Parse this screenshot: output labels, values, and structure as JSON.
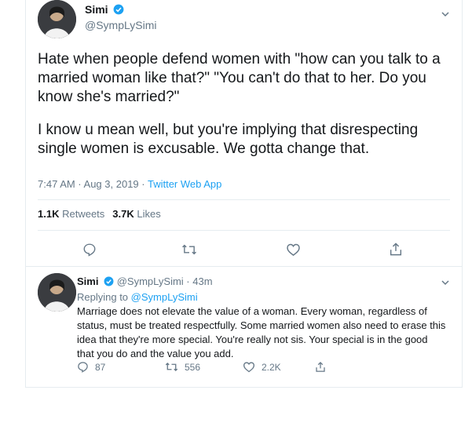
{
  "tweet": {
    "author_name": "Simi",
    "author_handle": "@SympLySimi",
    "text_paragraph_1": "Hate when people defend women with \"how can you talk to a married woman like that?\" \"You can't do that to her. Do you know she's married?\"",
    "text_paragraph_2": "I know u mean well, but you're implying that disrespecting single women is excusable. We gotta change that.",
    "time_date": "7:47 AM · Aug 3, 2019 · ",
    "source_app": "Twitter Web App",
    "retweets_count": "1.1K",
    "retweets_label": "Retweets",
    "likes_count": "3.7K",
    "likes_label": "Likes",
    "icons": [
      "reply-icon",
      "retweet-icon",
      "like-icon",
      "share-icon"
    ]
  },
  "reply": {
    "author_name": "Simi",
    "author_handle": "@SympLySimi",
    "time_ago": "· 43m",
    "replying_to_label": "Replying to ",
    "replying_to_handle": "@SympLySimi",
    "text": "Marriage does not elevate the value of a woman. Every woman, regardless of status, must be treated respectfully. Some married women also need to erase this idea that they're more special. You're really not sis. Your special is in the good that you do and the value you add.",
    "reply_count": "87",
    "retweet_count": "556",
    "like_count": "2.2K"
  },
  "colors": {
    "accent": "#1da1f2",
    "muted": "#657786",
    "text": "#14171a"
  }
}
